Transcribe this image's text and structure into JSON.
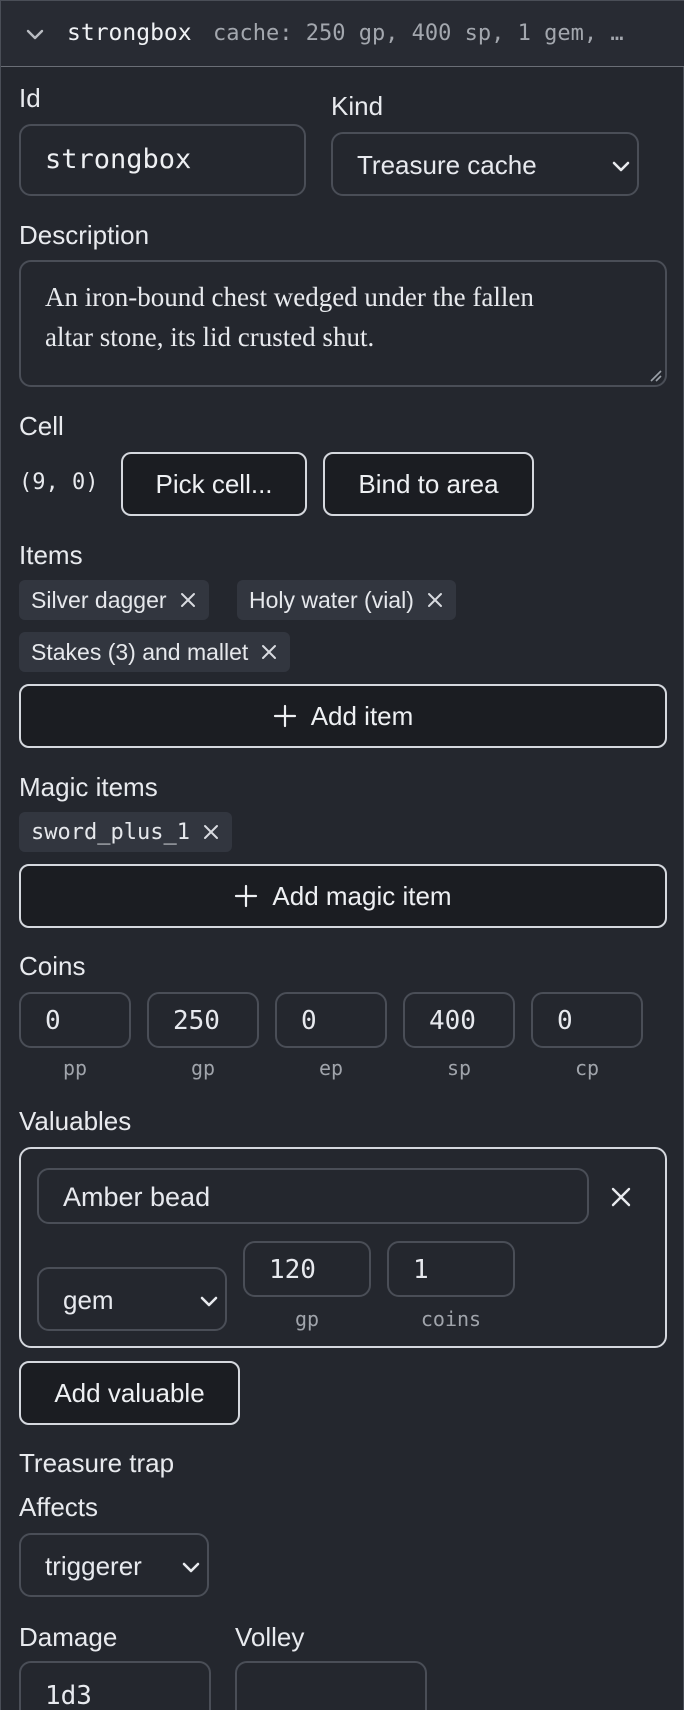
{
  "header": {
    "id": "strongbox",
    "summary": "cache: 250 gp, 400 sp, 1 gem, …"
  },
  "id_field": {
    "label": "Id",
    "value": "strongbox"
  },
  "kind": {
    "label": "Kind",
    "selected": "Treasure cache"
  },
  "description": {
    "label": "Description",
    "line1": "An iron-bound chest wedged under the fallen",
    "line2": "altar stone, its lid crusted shut."
  },
  "cell": {
    "label": "Cell",
    "value": "(9, 0)",
    "pick_button": "Pick cell...",
    "bind_button": "Bind to area"
  },
  "items": {
    "label": "Items",
    "chips": [
      "Silver dagger",
      "Holy water (vial)",
      "Stakes (3) and mallet"
    ],
    "add_button": "Add item"
  },
  "magic_items": {
    "label": "Magic items",
    "chips": [
      "sword_plus_1"
    ],
    "add_button": "Add magic item"
  },
  "coins": {
    "label": "Coins",
    "values": [
      {
        "value": "0",
        "unit": "pp"
      },
      {
        "value": "250",
        "unit": "gp"
      },
      {
        "value": "0",
        "unit": "ep"
      },
      {
        "value": "400",
        "unit": "sp"
      },
      {
        "value": "0",
        "unit": "cp"
      }
    ]
  },
  "valuables": {
    "label": "Valuables",
    "entries": [
      {
        "name": "Amber bead",
        "type": "gem",
        "value": "120",
        "value_unit": "gp",
        "count": "1",
        "count_unit": "coins"
      }
    ],
    "add_button": "Add valuable"
  },
  "trap": {
    "label": "Treasure trap",
    "affects_label": "Affects",
    "affects_selected": "triggerer",
    "damage_label": "Damage",
    "damage_value": "1d3",
    "volley_label": "Volley",
    "volley_value": ""
  },
  "colors": {
    "background": "#24272e",
    "border": "#4a4e57",
    "button_border": "#d5d8de",
    "chip": "#32363f"
  }
}
